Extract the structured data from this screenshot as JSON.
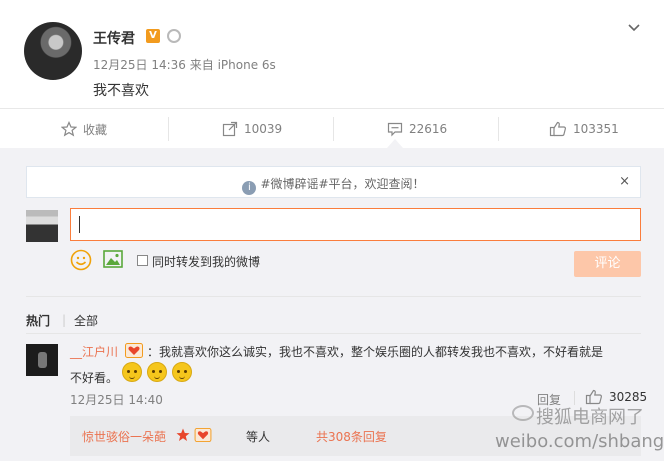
{
  "post": {
    "author": "王传君",
    "verified_badge": "V",
    "timestamp": "12月25日 14:36 来自 iPhone 6s",
    "text": "我不喜欢",
    "menu_icon": "chevron-down-icon"
  },
  "actions": {
    "favorite": "收藏",
    "repost": "10039",
    "comment": "22616",
    "like": "103351"
  },
  "comment_box": {
    "notice": "#微博辟谣#平台，欢迎查阅！",
    "notice_info_icon": "i",
    "close": "×",
    "checkbox_label": "同时转发到我的微博",
    "submit": "评论"
  },
  "tabs": {
    "hot": "热门",
    "separator": "|",
    "all": "全部"
  },
  "comments": [
    {
      "username": "__江户川",
      "text_line1": "：我就喜欢你这么诚实，我也不喜欢，整个娱乐圈的人都转发我也不喜欢，不好看就是",
      "text_line2": "不好看。",
      "time": "12月25日 14:40",
      "reply": "回复",
      "likes": "30285",
      "sub_reply": {
        "username": "惊世骇俗一朵葩",
        "suffix": "等人",
        "count": "共308条回复"
      }
    }
  ],
  "watermark": {
    "line1": "搜狐电商网了",
    "line2": "weibo.com/shbang"
  },
  "colors": {
    "accent": "#eb7350",
    "input_border": "#fa7d3c",
    "submit_disabled": "#fdc7a9",
    "badge": "#f29b1e"
  }
}
